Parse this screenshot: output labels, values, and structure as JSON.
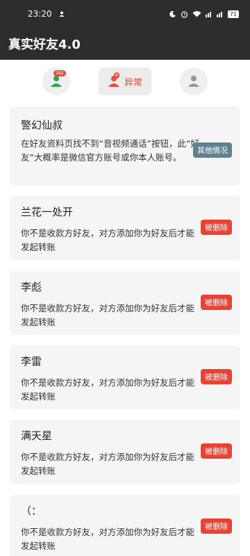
{
  "status_bar": {
    "time": "23:20",
    "battery": "71"
  },
  "app": {
    "title": "真实好友4.0"
  },
  "tabs": {
    "friends_badge": "282",
    "abnormal_badge": "8",
    "abnormal_label": "异常"
  },
  "cards": [
    {
      "name": "警幻仙叔",
      "desc": "在好友资料页找不到“音视频通话”按钮，此“好友”大概率是微信官方账号或你本人账号。",
      "button": "其他情况"
    },
    {
      "name": "兰花一处开",
      "desc": "你不是收款方好友，对方添加你为好友后才能发起转账",
      "button": "被删除"
    },
    {
      "name": "李彪",
      "desc": "你不是收款方好友，对方添加你为好友后才能发起转账",
      "button": "被删除"
    },
    {
      "name": "李雷",
      "desc": "你不是收款方好友，对方添加你为好友后才能发起转账",
      "button": "被删除"
    },
    {
      "name": "满天星",
      "desc": "你不是收款方好友，对方添加你为好友后才能发起转账",
      "button": "被删除"
    },
    {
      "name": "（：",
      "desc": "你不是收款方好友，对方添加你为好友后才能发起转账",
      "button": "被删除"
    }
  ]
}
